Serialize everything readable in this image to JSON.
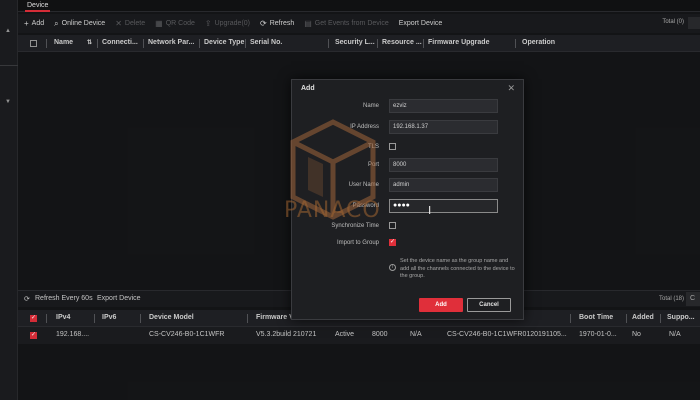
{
  "tabs": {
    "device": "Device"
  },
  "toolbar": {
    "add": "Add",
    "online_device": "Online Device",
    "delete": "Delete",
    "qr_code": "QR Code",
    "upgrade": "Upgrade(0)",
    "refresh": "Refresh",
    "get_events": "Get Events from Device",
    "export_device": "Export Device",
    "total": "Total (0)"
  },
  "device_table": {
    "columns": [
      "Name",
      "Connecti...",
      "Network Par...",
      "Device Type",
      "Serial No.",
      "Security L...",
      "Resource ...",
      "Firmware Upgrade",
      "Operation"
    ]
  },
  "online_toolbar": {
    "refresh": "Refresh Every 60s",
    "export": "Export Device",
    "total": "Total (18)",
    "extra": "C"
  },
  "online_table": {
    "columns": [
      "IPv4",
      "IPv6",
      "Device Model",
      "Firmware V",
      "Status",
      "Port",
      "Enhanced SDK",
      "Serial No.",
      "Boot Time",
      "Added",
      "Suppo..."
    ],
    "rows": [
      {
        "ipv4": "192.168....",
        "ipv6": "",
        "model": "CS-CV246-B0-1C1WFR",
        "firmware": "V5.3.2build 210721",
        "status": "Active",
        "port": "8000",
        "sdk": "N/A",
        "serial": "CS-CV246-B0-1C1WFR0120191105...",
        "boot": "1970-01-0...",
        "added": "No",
        "support": "N/A"
      }
    ]
  },
  "dialog": {
    "title": "Add",
    "labels": {
      "name": "Name",
      "ip": "IP Address",
      "tls": "TLS",
      "port": "Port",
      "user": "User Name",
      "password": "Password",
      "sync_time": "Synchronize Time",
      "import_group": "Import to Group"
    },
    "values": {
      "name": "ezviz",
      "ip": "192.168.1.37",
      "port": "8000",
      "user": "admin",
      "password_mask": "●●●●"
    },
    "info": "Set the device name as the group name and add all the channels connected to the device to the group.",
    "add_button": "Add",
    "cancel_button": "Cancel"
  },
  "watermark": {
    "text": "PANACO"
  },
  "colors": {
    "accent": "#e02f3a",
    "background": "#151618",
    "panel": "#1e1f22"
  }
}
